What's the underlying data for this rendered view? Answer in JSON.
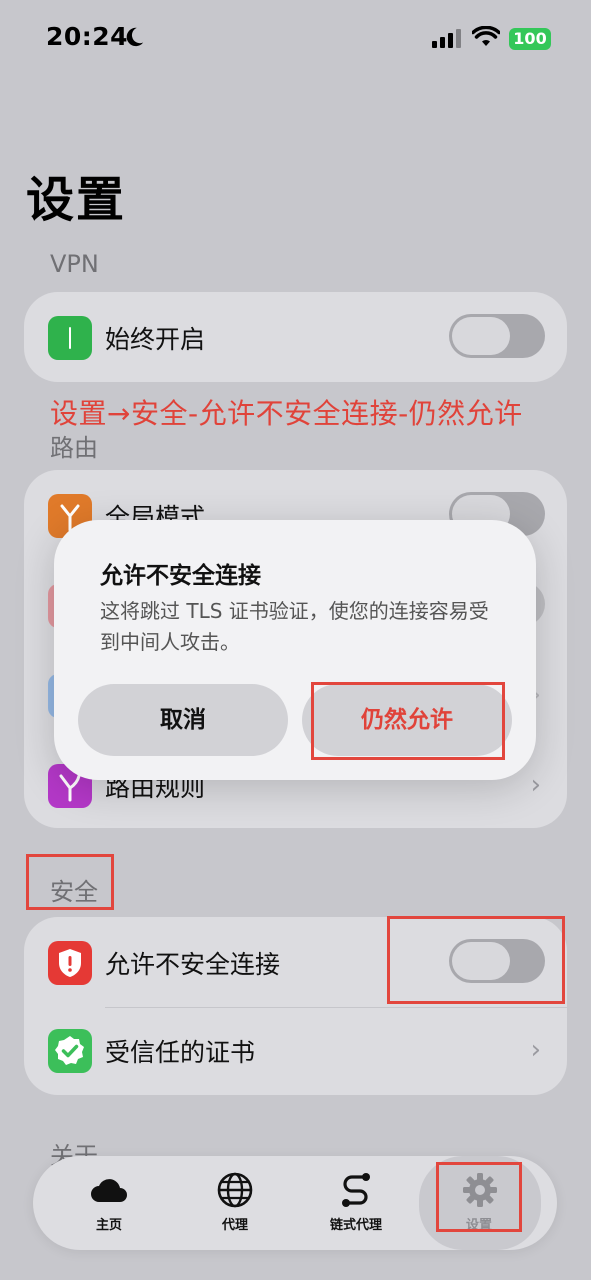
{
  "status_bar": {
    "time": "20:24",
    "battery": "100"
  },
  "page": {
    "title": "设置"
  },
  "vpn": {
    "section_label": "VPN",
    "always_on_label": "始终开启"
  },
  "annotation": "设置→安全-允许不安全连接-仍然允许",
  "routing": {
    "section_label": "路由",
    "global_mode_label": "全局模式",
    "rules_label": "路由规则"
  },
  "security": {
    "section_label": "安全",
    "allow_insecure_label": "允许不安全连接",
    "trusted_certs_label": "受信任的证书"
  },
  "about": {
    "section_label": "关于"
  },
  "dialog": {
    "title": "允许不安全连接",
    "message": "这将跳过 TLS 证书验证，使您的连接容易受到中间人攻击。",
    "cancel_label": "取消",
    "confirm_label": "仍然允许"
  },
  "tabbar": {
    "items": [
      {
        "label": "主页",
        "icon": "cloud-icon"
      },
      {
        "label": "代理",
        "icon": "globe-icon"
      },
      {
        "label": "链式代理",
        "icon": "route-icon"
      },
      {
        "label": "设置",
        "icon": "gear-icon"
      }
    ]
  },
  "colors": {
    "accent_red": "#e0433a",
    "vpn_icon_green": "#2fb24c",
    "global_icon_orange": "#e07a2a",
    "rules_icon_purple": "#b438c8",
    "shield_icon_red": "#e53935",
    "cert_icon_green": "#3cbf5a",
    "battery_green": "#34c759"
  }
}
